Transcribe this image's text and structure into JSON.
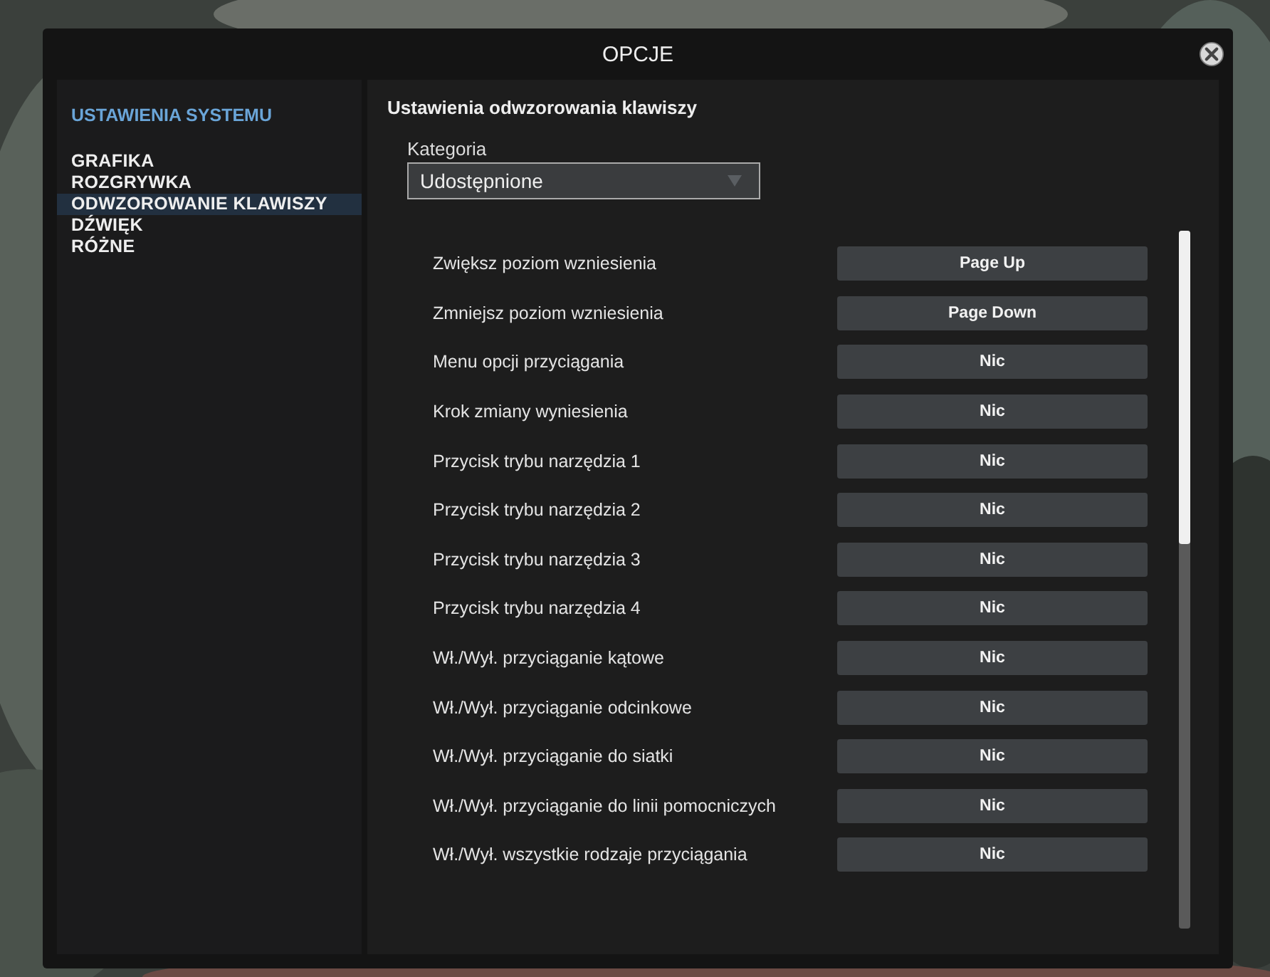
{
  "window": {
    "title": "OPCJE"
  },
  "sidebar": {
    "heading": "USTAWIENIA SYSTEMU",
    "items": [
      {
        "label": "GRAFIKA",
        "selected": false
      },
      {
        "label": "ROZGRYWKA",
        "selected": false
      },
      {
        "label": "ODWZOROWANIE KLAWISZY",
        "selected": true
      },
      {
        "label": "DŹWIĘK",
        "selected": false
      },
      {
        "label": "RÓŻNE",
        "selected": false
      }
    ]
  },
  "panel": {
    "title": "Ustawienia odwzorowania klawiszy",
    "category": {
      "label": "Kategoria",
      "value": "Udostępnione"
    },
    "bindings": [
      {
        "action": "Zwiększ poziom wzniesienia",
        "key": "Page Up"
      },
      {
        "action": "Zmniejsz poziom wzniesienia",
        "key": "Page Down"
      },
      {
        "action": "Menu opcji przyciągania",
        "key": "Nic"
      },
      {
        "action": "Krok zmiany wyniesienia",
        "key": "Nic"
      },
      {
        "action": "Przycisk trybu narzędzia 1",
        "key": "Nic"
      },
      {
        "action": "Przycisk trybu narzędzia 2",
        "key": "Nic"
      },
      {
        "action": "Przycisk trybu narzędzia 3",
        "key": "Nic"
      },
      {
        "action": "Przycisk trybu narzędzia 4",
        "key": "Nic"
      },
      {
        "action": "Wł./Wył. przyciąganie kątowe",
        "key": "Nic"
      },
      {
        "action": "Wł./Wył. przyciąganie odcinkowe",
        "key": "Nic"
      },
      {
        "action": "Wł./Wył. przyciąganie do siatki",
        "key": "Nic"
      },
      {
        "action": "Wł./Wył. przyciąganie do linii pomocniczych",
        "key": "Nic"
      },
      {
        "action": "Wł./Wył. wszystkie rodzaje przyciągania",
        "key": "Nic"
      }
    ]
  }
}
